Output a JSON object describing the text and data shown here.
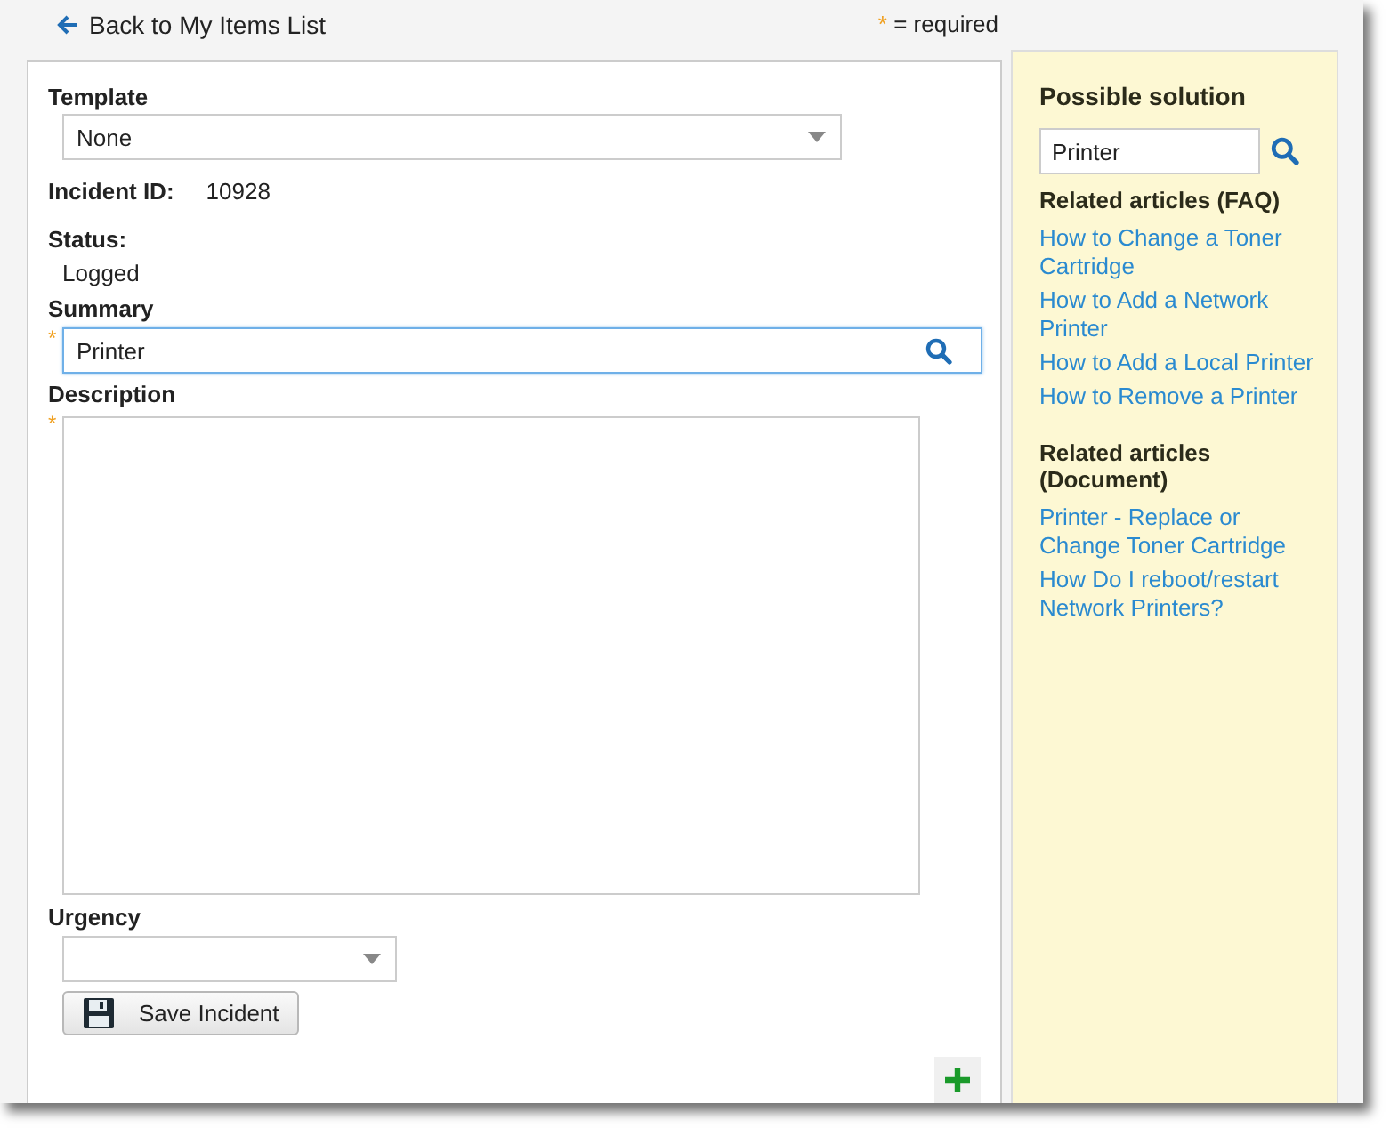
{
  "back_link": {
    "label": "Back to My Items List"
  },
  "required_note": {
    "mark": "*",
    "text": "= required"
  },
  "form": {
    "template": {
      "label": "Template",
      "value": "None"
    },
    "incident_id": {
      "label": "Incident ID:",
      "value": "10928"
    },
    "status": {
      "label": "Status:",
      "value": "Logged"
    },
    "summary": {
      "label": "Summary",
      "required": true,
      "value": "Printer"
    },
    "description": {
      "label": "Description",
      "required": true
    },
    "urgency": {
      "label": "Urgency"
    },
    "save_button": {
      "label": "Save Incident"
    }
  },
  "solution_panel": {
    "title": "Possible solution",
    "search_value": "Printer",
    "sections": [
      {
        "title": "Related articles (FAQ)",
        "links": [
          "How to Change a Toner Cartridge",
          "How to Add a Network Printer",
          "How to Add a Local Printer",
          "How to Remove a Printer"
        ]
      },
      {
        "title": "Related articles (Document)",
        "links": [
          "Printer - Replace or Change Toner Cartridge",
          "How Do I reboot/restart Network Printers?"
        ]
      }
    ]
  }
}
